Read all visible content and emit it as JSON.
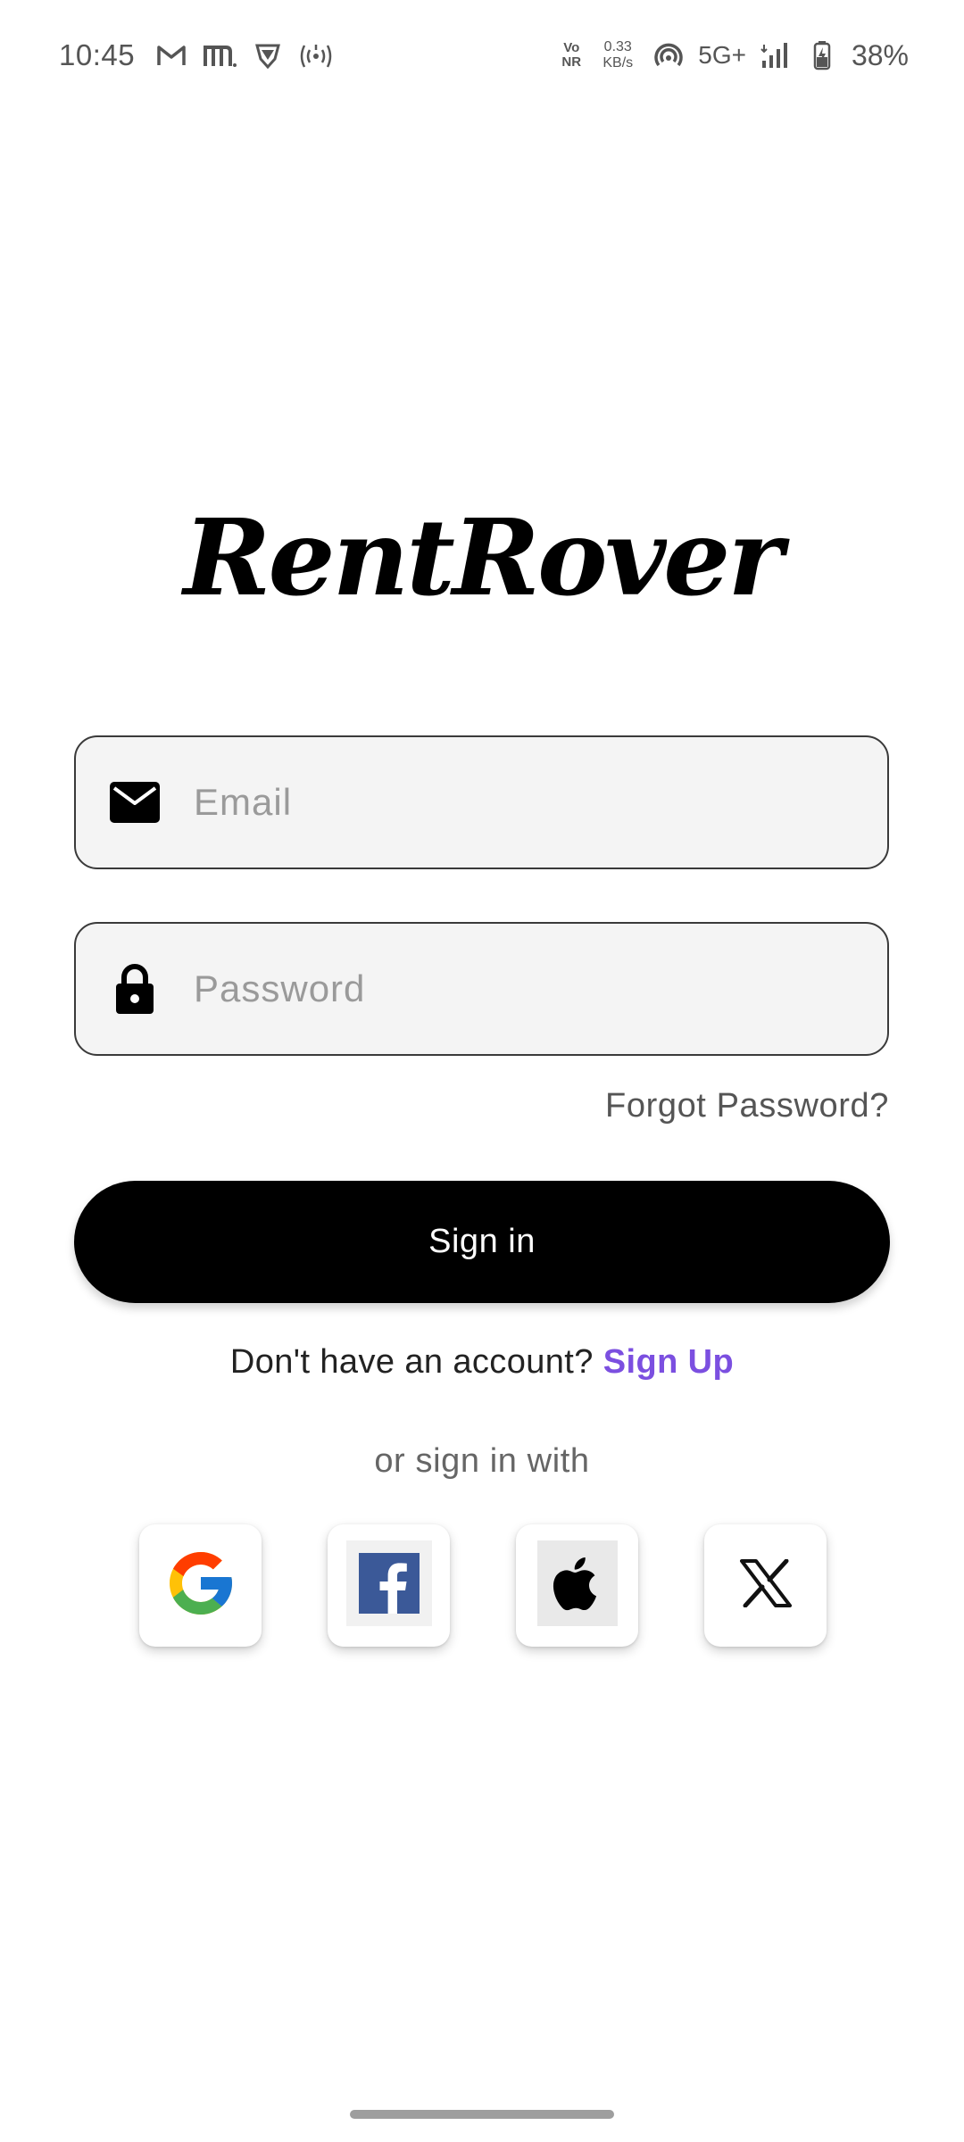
{
  "status_bar": {
    "time": "10:45",
    "left_icons": [
      "gmail-icon",
      "m-app-icon",
      "vpn-shield-icon",
      "hotspot-icon"
    ],
    "volte": [
      "Vo",
      "NR"
    ],
    "net_speed": [
      "0.33",
      "KB/s"
    ],
    "network_type": "5G+",
    "battery_percent": "38%",
    "right_icons": [
      "wifi-calling-icon",
      "signal-icon",
      "battery-icon"
    ]
  },
  "app": {
    "logo_text": "RentRover"
  },
  "form": {
    "email_placeholder": "Email",
    "password_placeholder": "Password",
    "forgot_password": "Forgot Password?",
    "sign_in_label": "Sign in"
  },
  "signup": {
    "prompt": "Don't have an account? ",
    "link": "Sign Up"
  },
  "social": {
    "or_text": "or sign in with",
    "providers": [
      "google-icon",
      "facebook-icon",
      "apple-icon",
      "x-icon"
    ]
  },
  "colors": {
    "accent": "#7b4fe0",
    "button_bg": "#000000",
    "field_bg": "#f4f4f4",
    "field_border": "#3a3a3a"
  }
}
